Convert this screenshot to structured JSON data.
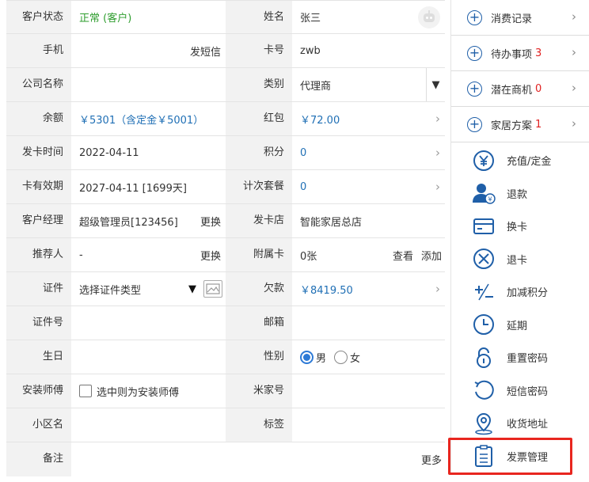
{
  "form": {
    "rows": [
      {
        "l1": "客户状态",
        "v1": "正常 (客户)",
        "l2": "姓名",
        "v2": "张三"
      },
      {
        "l1": "手机",
        "v1": "",
        "a1": "发短信",
        "l2": "卡号",
        "v2": "zwb"
      },
      {
        "l1": "公司名称",
        "v1": "",
        "l2": "类别",
        "v2": "代理商"
      },
      {
        "l1": "余额",
        "v1": "￥5301（含定金￥5001）",
        "l2": "红包",
        "v2": "￥72.00"
      },
      {
        "l1": "发卡时间",
        "v1": "2022-04-11",
        "l2": "积分",
        "v2": "0"
      },
      {
        "l1": "卡有效期",
        "v1": "2027-04-11 [1699天]",
        "l2": "计次套餐",
        "v2": "0"
      },
      {
        "l1": "客户经理",
        "v1": "超级管理员[123456]",
        "a1": "更换",
        "l2": "发卡店",
        "v2": "智能家居总店"
      },
      {
        "l1": "推荐人",
        "v1": "-",
        "a1": "更换",
        "l2": "附属卡",
        "v2": "0张",
        "a2": "查看",
        "a3": "添加"
      },
      {
        "l1": "证件",
        "v1": "选择证件类型",
        "l2": "欠款",
        "v2": "￥8419.50"
      },
      {
        "l1": "证件号",
        "v1": "",
        "l2": "邮箱",
        "v2": ""
      },
      {
        "l1": "生日",
        "v1": "",
        "l2": "性别",
        "r1": "男",
        "r2": "女"
      },
      {
        "l1": "安装师傅",
        "v1": "选中则为安装师傅",
        "l2": "米家号",
        "v2": ""
      },
      {
        "l1": "小区名",
        "v1": "",
        "l2": "标签",
        "v2": ""
      },
      {
        "l1": "备注",
        "v1": "",
        "a1": "更多"
      }
    ]
  },
  "menu": {
    "top": [
      {
        "label": "消费记录",
        "count": ""
      },
      {
        "label": "待办事项",
        "count": "3"
      },
      {
        "label": "潜在商机",
        "count": "0"
      },
      {
        "label": "家居方案",
        "count": "1"
      }
    ],
    "items": [
      {
        "label": "充值/定金",
        "icon": "yen-circle-icon"
      },
      {
        "label": "退款",
        "icon": "user-refund-icon"
      },
      {
        "label": "换卡",
        "icon": "card-icon"
      },
      {
        "label": "退卡",
        "icon": "x-circle-icon"
      },
      {
        "label": "加减积分",
        "icon": "plus-minus-icon"
      },
      {
        "label": "延期",
        "icon": "clock-icon"
      },
      {
        "label": "重置密码",
        "icon": "unlock-icon"
      },
      {
        "label": "短信密码",
        "icon": "refresh-icon"
      },
      {
        "label": "收货地址",
        "icon": "location-icon"
      },
      {
        "label": "发票管理",
        "icon": "invoice-icon"
      }
    ]
  },
  "colors": {
    "accent": "#1f5fa8",
    "highlight": "#e8261f",
    "status_green": "#2e9d2e",
    "count_red": "#e02020",
    "value_blue": "#1f6fb5"
  }
}
